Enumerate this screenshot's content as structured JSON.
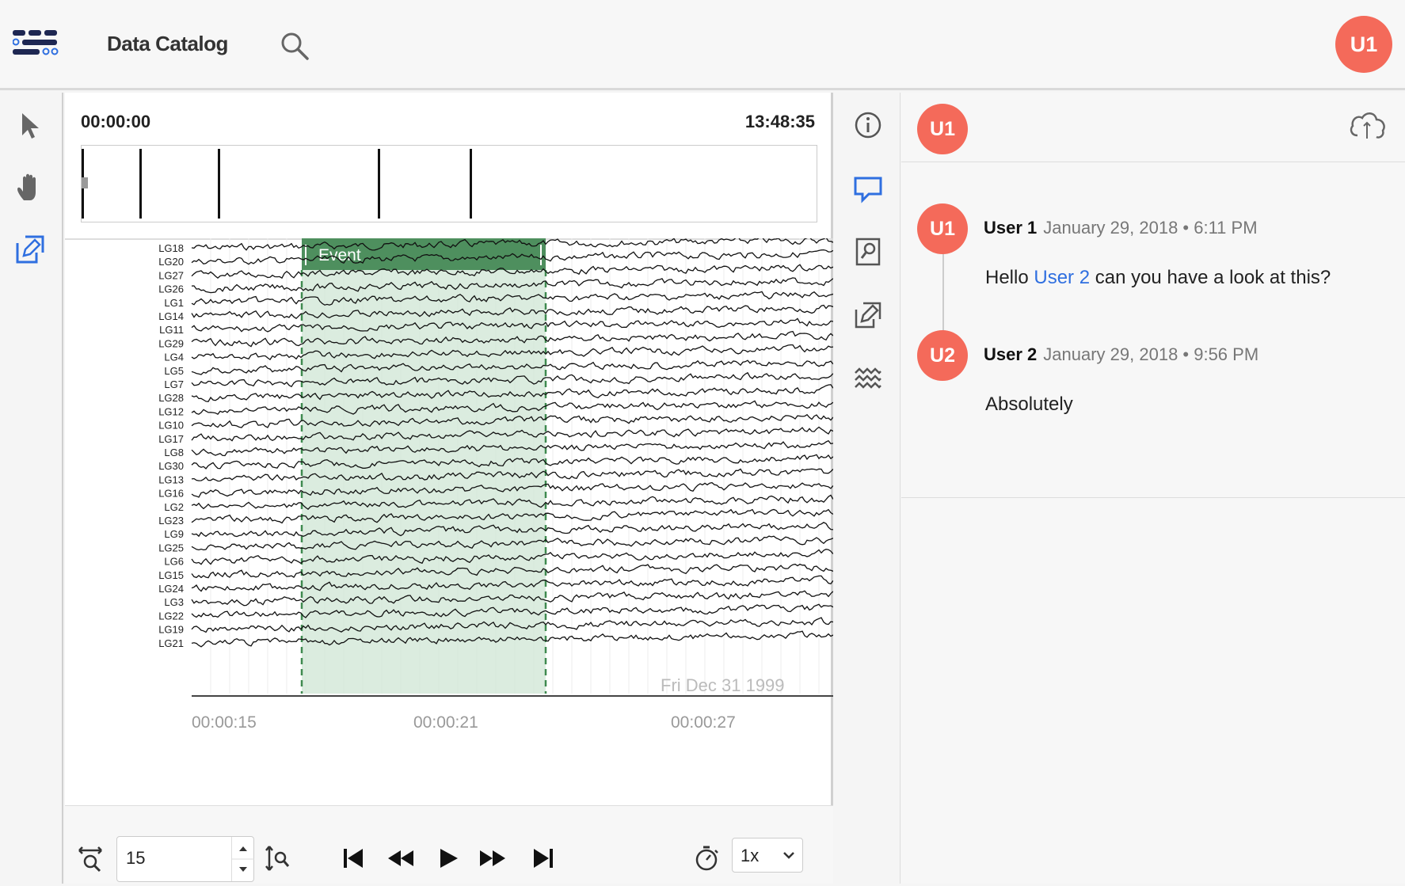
{
  "topbar": {
    "app_title": "Data Catalog",
    "user_initials": "U1"
  },
  "toolrail": {
    "tools": [
      {
        "name": "pointer-icon"
      },
      {
        "name": "hand-pan-icon"
      },
      {
        "name": "annotate-icon",
        "active": true
      }
    ]
  },
  "viewer": {
    "time_start": "00:00:00",
    "time_end": "13:48:35",
    "channels": [
      "LG18",
      "LG20",
      "LG27",
      "LG26",
      "LG1",
      "LG14",
      "LG11",
      "LG29",
      "LG4",
      "LG5",
      "LG7",
      "LG28",
      "LG12",
      "LG10",
      "LG17",
      "LG8",
      "LG30",
      "LG13",
      "LG16",
      "LG2",
      "LG23",
      "LG9",
      "LG25",
      "LG6",
      "LG15",
      "LG24",
      "LG3",
      "LG22",
      "LG19",
      "LG21"
    ],
    "event_label": "Event",
    "time_ticks": [
      "00:00:15",
      "00:00:21",
      "00:00:27"
    ],
    "watermark": "Fri Dec 31 1999",
    "footer": {
      "window_seconds": "15",
      "speed": "1x"
    }
  },
  "midrail": {
    "icons": [
      "info-icon",
      "comment-icon",
      "search-doc-icon",
      "annotate-icon",
      "waves-icon"
    ],
    "active": "comment-icon"
  },
  "comments": {
    "header_initials": "U1",
    "messages": [
      {
        "initials": "U1",
        "author": "User 1",
        "timestamp": "January 29, 2018 • 6:11 PM",
        "text_before": "Hello ",
        "mention": "User 2",
        "text_after": " can you have a look at this?"
      },
      {
        "initials": "U2",
        "author": "User 2",
        "timestamp": "January 29, 2018 • 9:56 PM",
        "text": "Absolutely"
      }
    ]
  },
  "colors": {
    "accent": "#2f6fe0",
    "avatar": "#f46a5a",
    "event_fill": "#4e8f5e"
  }
}
